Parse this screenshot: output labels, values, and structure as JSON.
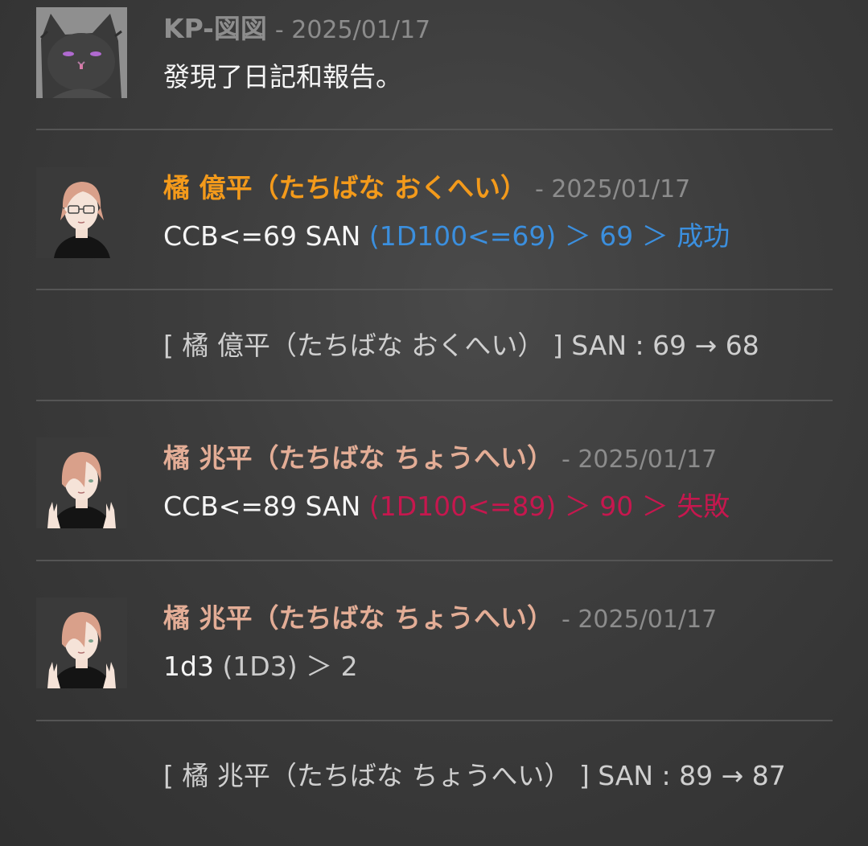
{
  "messages": [
    {
      "speaker": "KP-図図",
      "speaker_color": "#8e8e8e",
      "date": "- 2025/01/17",
      "body": "發現了日記和報告。",
      "avatar": "black-cat-avatar"
    },
    {
      "speaker": "橘 億平（たちばな おくへい）",
      "speaker_color": "#f39a1b",
      "date": "- 2025/01/17",
      "body_prefix": "CCB<=69 SAN ",
      "body_result": "(1D100<=69) ＞ 69 ＞ 成功",
      "result_color": "#3b8fde",
      "avatar": "glasses-man-avatar"
    },
    {
      "system_text": "[ 橘 億平（たちばな おくへい） ] SAN : 69 → 68"
    },
    {
      "speaker": "橘 兆平（たちばな ちょうへい）",
      "speaker_color": "#e3ad96",
      "date": "- 2025/01/17",
      "body_prefix": "CCB<=89 SAN ",
      "body_result": "(1D100<=89) ＞ 90 ＞ 失敗",
      "result_color": "#c6174e",
      "avatar": "peace-sign-man-avatar"
    },
    {
      "speaker": "橘 兆平（たちばな ちょうへい）",
      "speaker_color": "#e3ad96",
      "date": "- 2025/01/17",
      "body_prefix": "1d3 ",
      "body_result": "(1D3) ＞ 2",
      "result_color": "#cccccc",
      "avatar": "peace-sign-man-avatar"
    },
    {
      "system_text": "[ 橘 兆平（たちばな ちょうへい） ] SAN : 89 → 87"
    }
  ]
}
